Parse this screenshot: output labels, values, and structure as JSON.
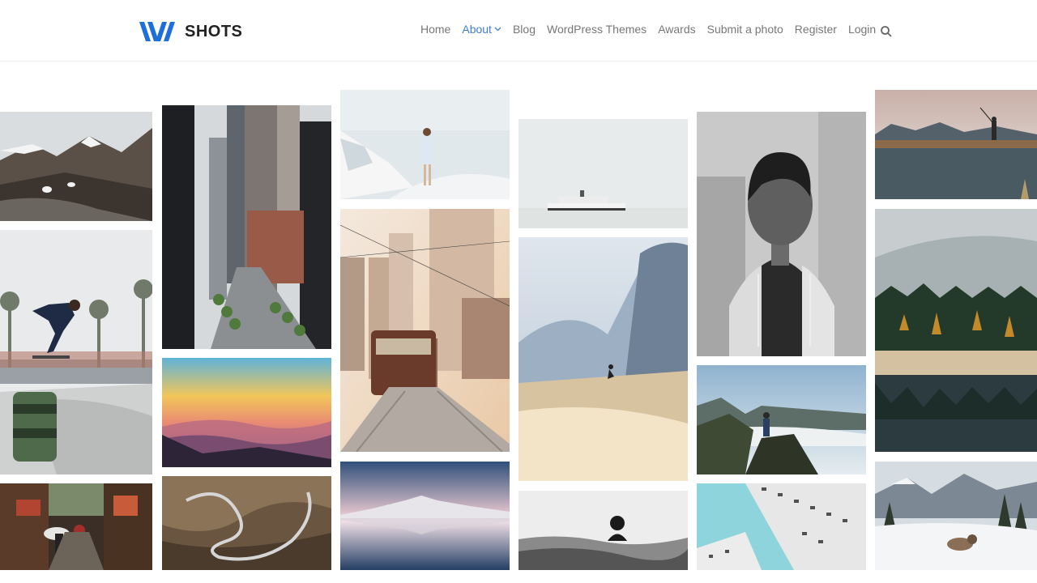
{
  "brand": {
    "name": "SHOTS",
    "logo_icon": "wm-logo-icon",
    "accent": "#1e6fd9"
  },
  "nav": {
    "items": [
      {
        "label": "Home",
        "active": false
      },
      {
        "label": "About",
        "active": true,
        "has_dropdown": true
      },
      {
        "label": "Blog",
        "active": false
      },
      {
        "label": "WordPress Themes",
        "active": false
      },
      {
        "label": "Awards",
        "active": false
      },
      {
        "label": "Submit a photo",
        "active": false
      },
      {
        "label": "Register",
        "active": false
      },
      {
        "label": "Login",
        "active": false
      }
    ],
    "search_icon": "search-icon",
    "active_color": "#3f7fd1"
  },
  "gallery": {
    "columns": [
      {
        "photos": [
          "photo-mountain-sheep",
          "photo-skateboarder",
          "photo-alley-umbrella"
        ]
      },
      {
        "photos": [
          "photo-city-skyscrapers",
          "photo-sunset-mountains",
          "photo-winding-road"
        ]
      },
      {
        "photos": [
          "photo-santorini-woman",
          "photo-tram-street",
          "photo-lake-reflection"
        ]
      },
      {
        "photos": [
          "photo-ship-fog",
          "photo-skier-cliff",
          "photo-swimmer-bw"
        ]
      },
      {
        "photos": [
          "photo-woman-portrait",
          "photo-hiker-clouds",
          "photo-building-lookup"
        ]
      },
      {
        "photos": [
          "photo-fisherman-lake",
          "photo-forest-lake",
          "photo-dog-snow"
        ]
      }
    ]
  }
}
